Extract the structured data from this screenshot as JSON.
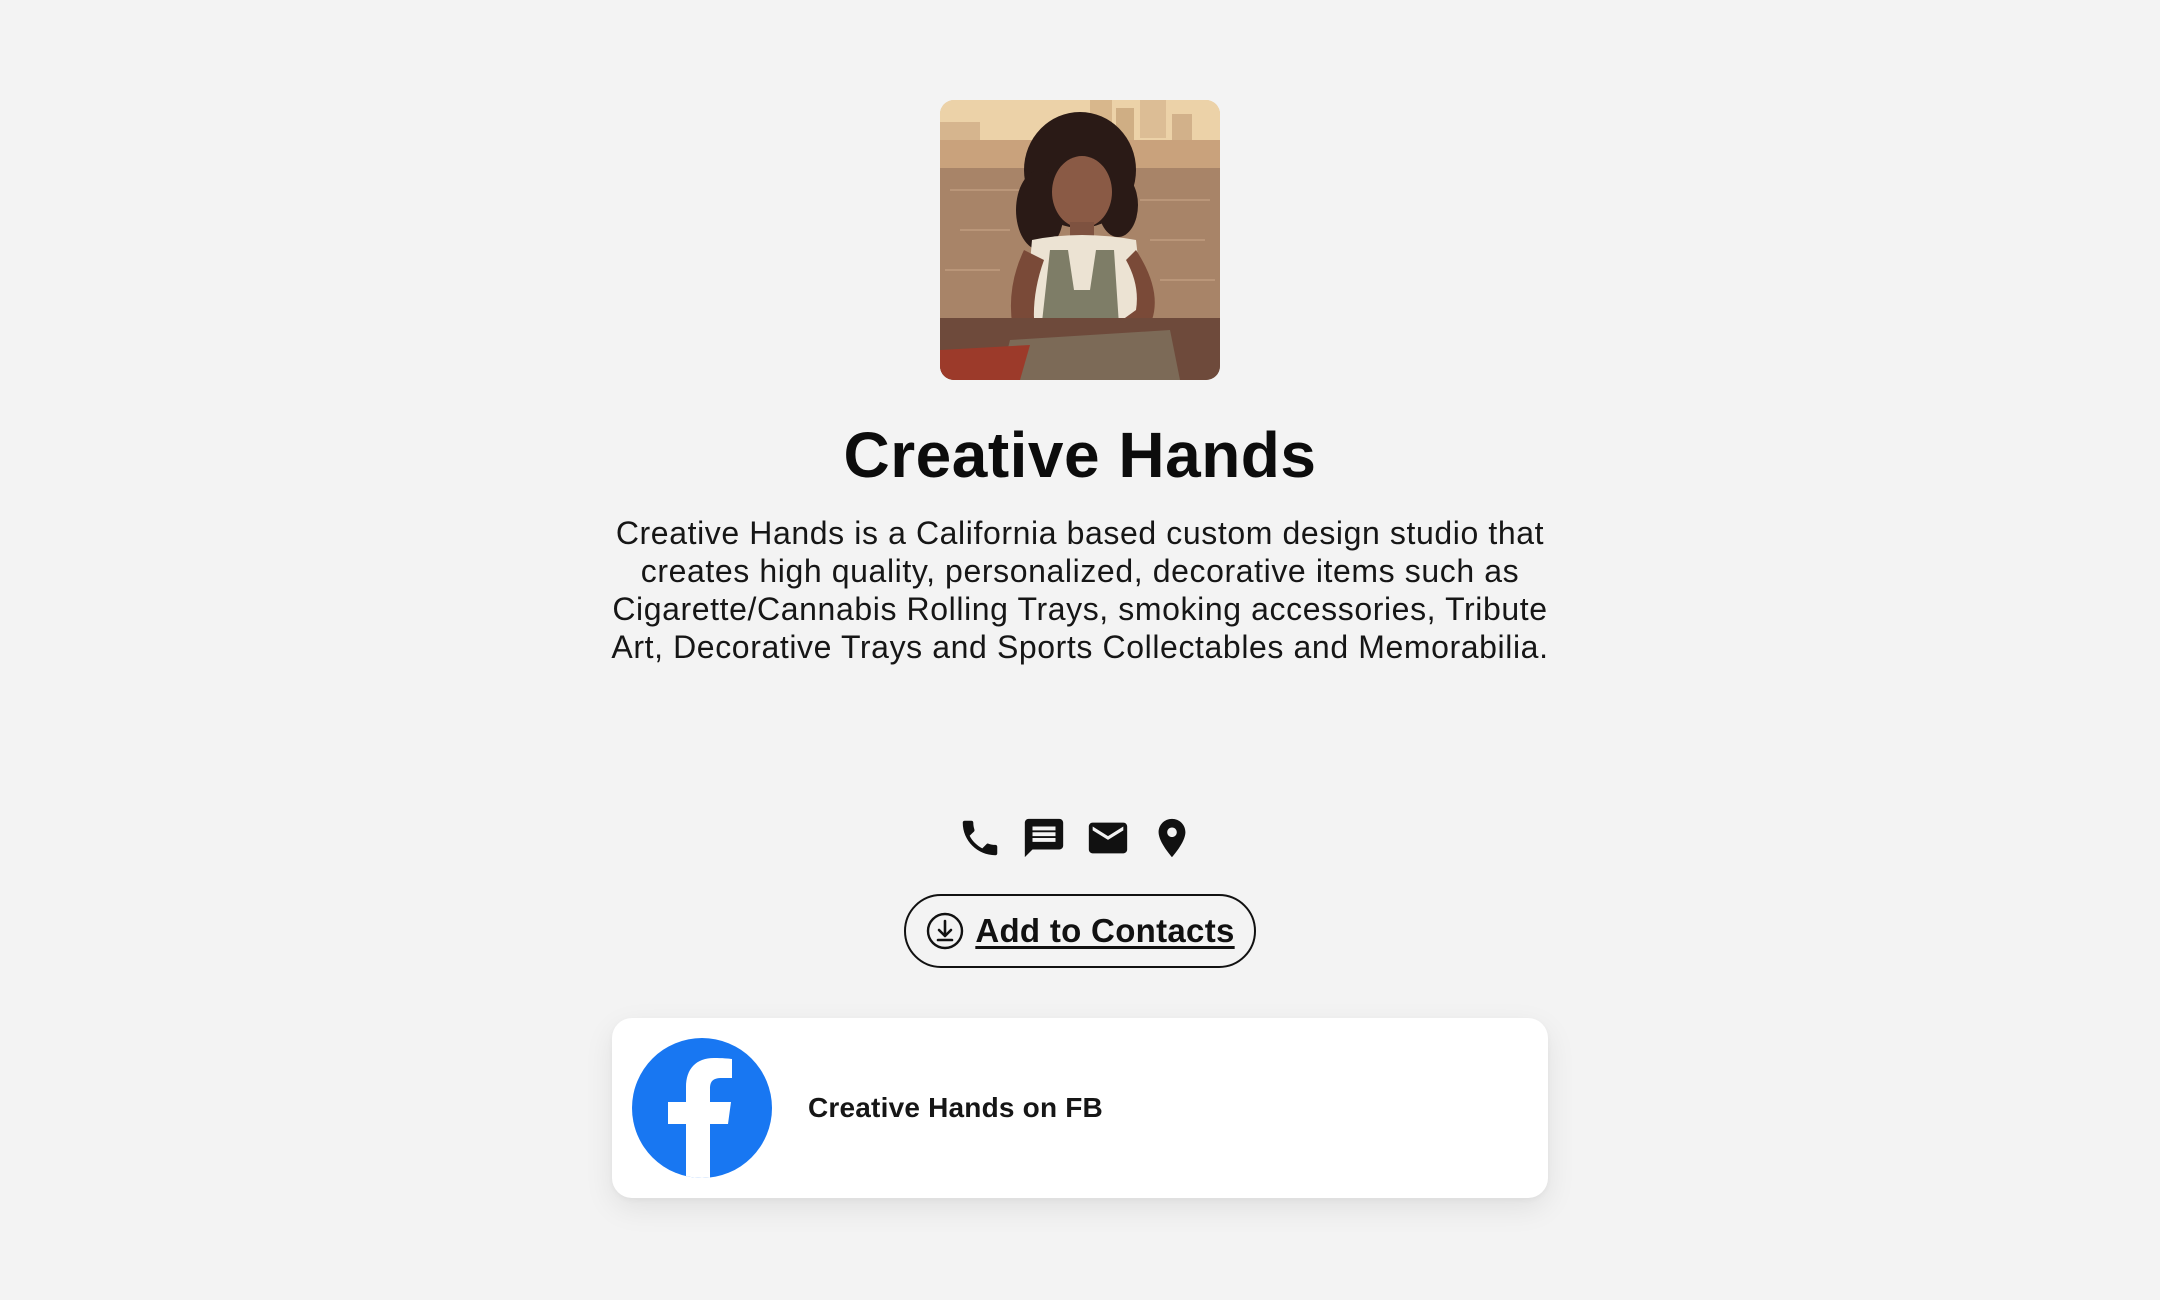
{
  "profile": {
    "name": "Creative Hands",
    "bio": "Creative Hands is a California based custom design studio that creates high quality, personalized, decorative items such as Cigarette/Cannabis Rolling Trays, smoking accessories, Tribute Art, Decorative Trays and Sports Collectables and Memorabilia."
  },
  "contact_icons": [
    "phone-icon",
    "message-icon",
    "email-icon",
    "location-icon"
  ],
  "actions": {
    "add_to_contacts_label": "Add to Contacts"
  },
  "links": [
    {
      "label": "Creative Hands on FB",
      "icon": "facebook-icon"
    }
  ],
  "colors": {
    "background": "#f3f3f3",
    "facebook_blue": "#1877f2",
    "text": "#111111"
  }
}
